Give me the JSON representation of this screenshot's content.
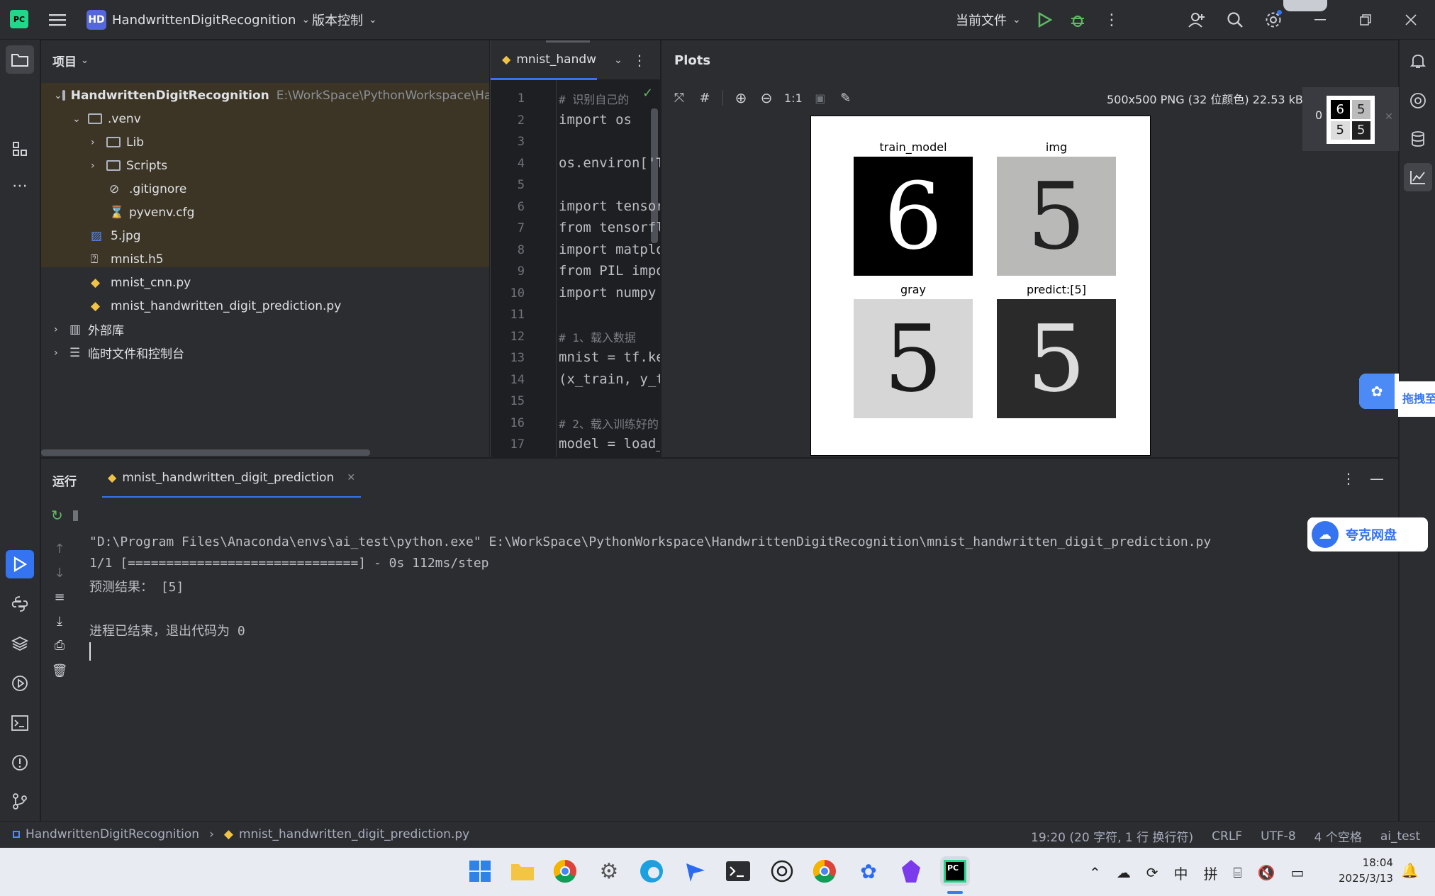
{
  "titlebar": {
    "project_badge": "HD",
    "project_name": "HandwrittenDigitRecognition",
    "vcs": "版本控制",
    "run_config": "当前文件"
  },
  "project_panel": {
    "title": "项目",
    "root_name": "HandwrittenDigitRecognition",
    "root_path": "E:\\WorkSpace\\PythonWorkspace\\Hand",
    "items": [
      {
        "label": ".venv"
      },
      {
        "label": "Lib"
      },
      {
        "label": "Scripts"
      },
      {
        "label": ".gitignore"
      },
      {
        "label": "pyvenv.cfg"
      },
      {
        "label": "5.jpg"
      },
      {
        "label": "mnist.h5"
      },
      {
        "label": "mnist_cnn.py"
      },
      {
        "label": "mnist_handwritten_digit_prediction.py"
      },
      {
        "label": "外部库"
      },
      {
        "label": "临时文件和控制台"
      }
    ]
  },
  "editor": {
    "tab_label": "mnist_handw",
    "lines": [
      {
        "n": "1",
        "code": "# 识别自己的"
      },
      {
        "n": "2",
        "code": "import os"
      },
      {
        "n": "3",
        "code": ""
      },
      {
        "n": "4",
        "code": "os.environ['T"
      },
      {
        "n": "5",
        "code": ""
      },
      {
        "n": "6",
        "code": "import tensor"
      },
      {
        "n": "7",
        "code": "from tensorfl"
      },
      {
        "n": "8",
        "code": "import matplo"
      },
      {
        "n": "9",
        "code": "from PIL impo"
      },
      {
        "n": "10",
        "code": "import numpy"
      },
      {
        "n": "11",
        "code": ""
      },
      {
        "n": "12",
        "code": "# 1、载入数据"
      },
      {
        "n": "13",
        "code": "mnist = tf.ke"
      },
      {
        "n": "14",
        "code": "(x_train, y_t"
      },
      {
        "n": "15",
        "code": ""
      },
      {
        "n": "16",
        "code": "# 2、载入训练好的"
      },
      {
        "n": "17",
        "code": "model = load_"
      }
    ]
  },
  "plots": {
    "title": "Plots",
    "zoom_label": "1:1",
    "image_info": "500x500 PNG (32 位颜色) 22.53 kB",
    "thumb_index": "0",
    "subplots": [
      {
        "title": "train_model",
        "digit": "6"
      },
      {
        "title": "img",
        "digit": "5"
      },
      {
        "title": "gray",
        "digit": "5"
      },
      {
        "title": "predict:[5]",
        "digit": "5"
      }
    ],
    "drag_hint": "拖拽至",
    "quark_label": "夸克网盘"
  },
  "run_panel": {
    "run_tab": "运行",
    "config_tab": "mnist_handwritten_digit_prediction",
    "console": [
      "\"D:\\Program Files\\Anaconda\\envs\\ai_test\\python.exe\" E:\\WorkSpace\\PythonWorkspace\\HandwrittenDigitRecognition\\mnist_handwritten_digit_prediction.py",
      "1/1 [==============================] - 0s 112ms/step",
      "预测结果： [5]",
      "",
      "进程已结束，退出代码为 0"
    ]
  },
  "statusbar": {
    "breadcrumb_project": "HandwrittenDigitRecognition",
    "breadcrumb_file": "mnist_handwritten_digit_prediction.py",
    "position": "19:20 (20 字符, 1 行 换行符)",
    "line_sep": "CRLF",
    "encoding": "UTF-8",
    "indent": "4 个空格",
    "interpreter": "ai_test"
  },
  "taskbar": {
    "ime1": "中",
    "ime2": "拼",
    "time": "18:04",
    "date": "2025/3/13"
  }
}
